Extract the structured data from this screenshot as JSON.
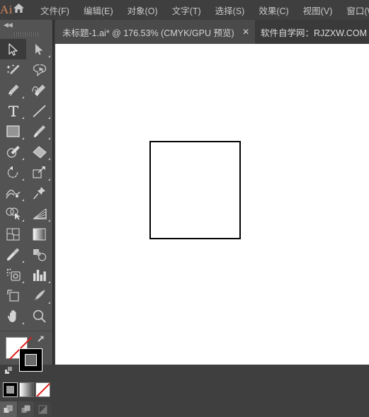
{
  "app": {
    "logo_text": "Ai",
    "home_icon": "home-icon",
    "title": "Adobe Illustrator"
  },
  "menubar": {
    "items": [
      {
        "label": "文件(F)",
        "name": "menu-file"
      },
      {
        "label": "编辑(E)",
        "name": "menu-edit"
      },
      {
        "label": "对象(O)",
        "name": "menu-object"
      },
      {
        "label": "文字(T)",
        "name": "menu-type"
      },
      {
        "label": "选择(S)",
        "name": "menu-select"
      },
      {
        "label": "效果(C)",
        "name": "menu-effect"
      },
      {
        "label": "视图(V)",
        "name": "menu-view"
      },
      {
        "label": "窗口(W)",
        "name": "menu-window"
      }
    ]
  },
  "tabs": {
    "active": {
      "label": "未标题-1.ai* @ 176.53% (CMYK/GPU 预览)",
      "document_name": "未标题-1.ai*",
      "zoom_level": "176.53%",
      "color_mode": "CMYK",
      "preview_mode": "GPU 预览",
      "close_glyph": "✕"
    },
    "promo": {
      "label": "软件自学网：RJZXW.COM"
    }
  },
  "toolbar": {
    "collapse_glyph": "◀◀",
    "tools": [
      {
        "name": "selection-tool",
        "label": "选择工具",
        "active": true,
        "corner": false
      },
      {
        "name": "direct-selection-tool",
        "label": "直接选择工具",
        "active": false,
        "corner": true
      },
      {
        "name": "magic-wand-tool",
        "label": "魔棒工具",
        "active": false,
        "corner": false
      },
      {
        "name": "lasso-tool",
        "label": "套索工具",
        "active": false,
        "corner": false
      },
      {
        "name": "pen-tool",
        "label": "钢笔工具",
        "active": false,
        "corner": true
      },
      {
        "name": "curvature-tool",
        "label": "曲率工具",
        "active": false,
        "corner": false
      },
      {
        "name": "type-tool",
        "label": "文字工具",
        "active": false,
        "corner": true
      },
      {
        "name": "line-segment-tool",
        "label": "直线段工具",
        "active": false,
        "corner": true
      },
      {
        "name": "rectangle-tool",
        "label": "矩形工具",
        "active": false,
        "corner": true
      },
      {
        "name": "paintbrush-tool",
        "label": "画笔工具",
        "active": false,
        "corner": true
      },
      {
        "name": "shaper-pencil-tool",
        "label": "Shaper 工具",
        "active": false,
        "corner": true
      },
      {
        "name": "eraser-tool",
        "label": "橡皮擦工具",
        "active": false,
        "corner": true
      },
      {
        "name": "rotate-tool",
        "label": "旋转工具",
        "active": false,
        "corner": true
      },
      {
        "name": "scale-tool",
        "label": "比例缩放工具",
        "active": false,
        "corner": true
      },
      {
        "name": "width-tool",
        "label": "宽度工具",
        "active": false,
        "corner": true
      },
      {
        "name": "free-transform-tool",
        "label": "自由变换工具",
        "active": false,
        "corner": false
      },
      {
        "name": "shape-builder-tool",
        "label": "形状生成器工具",
        "active": false,
        "corner": true
      },
      {
        "name": "perspective-grid-tool",
        "label": "透视网格工具",
        "active": false,
        "corner": true
      },
      {
        "name": "mesh-tool",
        "label": "网格工具",
        "active": false,
        "corner": false
      },
      {
        "name": "gradient-tool",
        "label": "渐变工具",
        "active": false,
        "corner": false
      },
      {
        "name": "eyedropper-tool",
        "label": "吸管工具",
        "active": false,
        "corner": true
      },
      {
        "name": "blend-tool",
        "label": "混合工具",
        "active": false,
        "corner": false
      },
      {
        "name": "symbol-sprayer-tool",
        "label": "符号喷枪工具",
        "active": false,
        "corner": true
      },
      {
        "name": "column-graph-tool",
        "label": "柱形图工具",
        "active": false,
        "corner": true
      },
      {
        "name": "artboard-tool",
        "label": "画板工具",
        "active": false,
        "corner": false
      },
      {
        "name": "slice-tool",
        "label": "切片工具",
        "active": false,
        "corner": true
      },
      {
        "name": "hand-tool",
        "label": "抓手工具",
        "active": false,
        "corner": true
      },
      {
        "name": "zoom-tool",
        "label": "缩放工具",
        "active": false,
        "corner": false
      }
    ],
    "fill_stroke": {
      "fill_label": "填色",
      "fill_color": "none",
      "stroke_label": "描边",
      "stroke_color": "#000000",
      "swap_label": "互换填色和描边",
      "default_label": "默认填色和描边"
    },
    "color_modes": [
      {
        "name": "color-mode-color",
        "label": "颜色",
        "selected": true
      },
      {
        "name": "color-mode-gradient",
        "label": "渐变",
        "selected": false
      },
      {
        "name": "color-mode-none",
        "label": "无",
        "selected": false
      }
    ],
    "draw_modes": [
      {
        "name": "draw-mode-normal",
        "label": "正常绘图",
        "selected": true,
        "dim": false
      },
      {
        "name": "draw-mode-behind",
        "label": "背面绘图",
        "selected": false,
        "dim": false
      },
      {
        "name": "draw-mode-inside",
        "label": "内部绘图",
        "selected": false,
        "dim": true
      }
    ]
  },
  "canvas": {
    "background": "#ffffff",
    "shape": {
      "name": "rectangle-shape",
      "fill": "#ffffff",
      "stroke": "#000000",
      "stroke_width": "2px"
    }
  }
}
